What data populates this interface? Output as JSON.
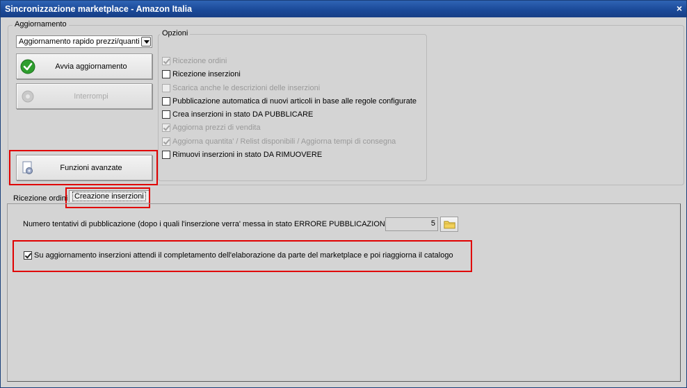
{
  "window": {
    "title": "Sincronizzazione marketplace - Amazon Italia",
    "close_glyph": "×"
  },
  "aggiornamento": {
    "legend": "Aggiornamento",
    "select_value": "Aggiornamento rapido prezzi/quanti",
    "start_label": "Avvia aggiornamento",
    "stop_label": "Interrompi",
    "advanced_label": "Funzioni avanzate"
  },
  "opzioni": {
    "legend": "Opzioni",
    "items": [
      {
        "label": "Ricezione ordini",
        "checked": true,
        "enabled": false
      },
      {
        "label": "Ricezione inserzioni",
        "checked": false,
        "enabled": true
      },
      {
        "label": "Scarica anche le descrizioni delle inserzioni",
        "checked": false,
        "enabled": false
      },
      {
        "label": "Pubblicazione automatica di nuovi articoli in base alle regole configurate",
        "checked": false,
        "enabled": true
      },
      {
        "label": "Crea inserzioni in stato DA PUBBLICARE",
        "checked": false,
        "enabled": true
      },
      {
        "label": "Aggiorna prezzi di vendita",
        "checked": true,
        "enabled": false
      },
      {
        "label": "Aggiorna quantita' / Relist disponibili / Aggiorna tempi di consegna",
        "checked": true,
        "enabled": false
      },
      {
        "label": "Rimuovi inserzioni in stato DA RIMUOVERE",
        "checked": false,
        "enabled": true
      }
    ]
  },
  "tabs": [
    {
      "label": "Ricezione ordini"
    },
    {
      "label": "Creazione inserzioni"
    }
  ],
  "creazione": {
    "tentativi_label": "Numero tentativi di pubblicazione (dopo i quali l'inserzione verra' messa in stato ERRORE PUBBLICAZIONE) :",
    "tentativi_value": "5",
    "attendi_label": "Su aggiornamento inserzioni attendi il completamento dell'elaborazione da parte del marketplace e poi riaggiorna il catalogo",
    "attendi_checked": true
  },
  "colors": {
    "titlebar": "#1b4a99",
    "highlight": "#e00000",
    "check_green": "#2e9e2e"
  }
}
